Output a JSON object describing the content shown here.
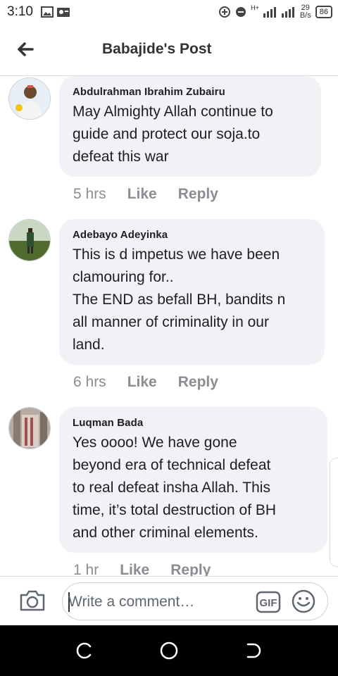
{
  "status_bar": {
    "time": "3:10",
    "net_type": "H+",
    "net_speed_value": "29",
    "net_speed_unit": "B/s",
    "battery": "86"
  },
  "header": {
    "title": "Babajide's Post",
    "back_icon": "arrow-left-icon"
  },
  "comments": [
    {
      "author": "Abdulrahman Ibrahim Zubairu",
      "text": "May Almighty Allah continue to\nguide and protect our soja.to\ndefeat this war",
      "time": "5 hrs",
      "like_label": "Like",
      "reply_label": "Reply"
    },
    {
      "author": "Adebayo Adeyinka",
      "text": "This is d impetus we have been\nclamouring for..\nThe END as befall BH, bandits n\nall manner of criminality in our\nland.",
      "time": "6 hrs",
      "like_label": "Like",
      "reply_label": "Reply"
    },
    {
      "author": "Luqman Bada",
      "text": "Yes oooo! We have gone\nbeyond era of technical defeat\nto real defeat insha Allah. This\ntime, it’s total destruction of BH\nand other criminal elements.",
      "time": "1 hr",
      "like_label": "Like",
      "reply_label": "Reply"
    }
  ],
  "composer": {
    "placeholder": "Write a comment…",
    "gif_label": "GIF"
  },
  "colors": {
    "bubble": "#f0f2f5",
    "meta_text": "#8a8d91",
    "navbar": "#000000"
  }
}
